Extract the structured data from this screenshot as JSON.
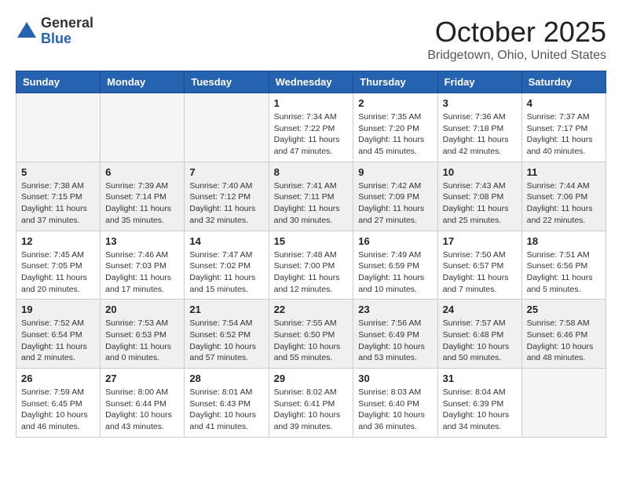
{
  "header": {
    "logo_general": "General",
    "logo_blue": "Blue",
    "month_title": "October 2025",
    "location": "Bridgetown, Ohio, United States"
  },
  "days_of_week": [
    "Sunday",
    "Monday",
    "Tuesday",
    "Wednesday",
    "Thursday",
    "Friday",
    "Saturday"
  ],
  "weeks": [
    [
      {
        "num": "",
        "info": ""
      },
      {
        "num": "",
        "info": ""
      },
      {
        "num": "",
        "info": ""
      },
      {
        "num": "1",
        "info": "Sunrise: 7:34 AM\nSunset: 7:22 PM\nDaylight: 11 hours and 47 minutes."
      },
      {
        "num": "2",
        "info": "Sunrise: 7:35 AM\nSunset: 7:20 PM\nDaylight: 11 hours and 45 minutes."
      },
      {
        "num": "3",
        "info": "Sunrise: 7:36 AM\nSunset: 7:18 PM\nDaylight: 11 hours and 42 minutes."
      },
      {
        "num": "4",
        "info": "Sunrise: 7:37 AM\nSunset: 7:17 PM\nDaylight: 11 hours and 40 minutes."
      }
    ],
    [
      {
        "num": "5",
        "info": "Sunrise: 7:38 AM\nSunset: 7:15 PM\nDaylight: 11 hours and 37 minutes."
      },
      {
        "num": "6",
        "info": "Sunrise: 7:39 AM\nSunset: 7:14 PM\nDaylight: 11 hours and 35 minutes."
      },
      {
        "num": "7",
        "info": "Sunrise: 7:40 AM\nSunset: 7:12 PM\nDaylight: 11 hours and 32 minutes."
      },
      {
        "num": "8",
        "info": "Sunrise: 7:41 AM\nSunset: 7:11 PM\nDaylight: 11 hours and 30 minutes."
      },
      {
        "num": "9",
        "info": "Sunrise: 7:42 AM\nSunset: 7:09 PM\nDaylight: 11 hours and 27 minutes."
      },
      {
        "num": "10",
        "info": "Sunrise: 7:43 AM\nSunset: 7:08 PM\nDaylight: 11 hours and 25 minutes."
      },
      {
        "num": "11",
        "info": "Sunrise: 7:44 AM\nSunset: 7:06 PM\nDaylight: 11 hours and 22 minutes."
      }
    ],
    [
      {
        "num": "12",
        "info": "Sunrise: 7:45 AM\nSunset: 7:05 PM\nDaylight: 11 hours and 20 minutes."
      },
      {
        "num": "13",
        "info": "Sunrise: 7:46 AM\nSunset: 7:03 PM\nDaylight: 11 hours and 17 minutes."
      },
      {
        "num": "14",
        "info": "Sunrise: 7:47 AM\nSunset: 7:02 PM\nDaylight: 11 hours and 15 minutes."
      },
      {
        "num": "15",
        "info": "Sunrise: 7:48 AM\nSunset: 7:00 PM\nDaylight: 11 hours and 12 minutes."
      },
      {
        "num": "16",
        "info": "Sunrise: 7:49 AM\nSunset: 6:59 PM\nDaylight: 11 hours and 10 minutes."
      },
      {
        "num": "17",
        "info": "Sunrise: 7:50 AM\nSunset: 6:57 PM\nDaylight: 11 hours and 7 minutes."
      },
      {
        "num": "18",
        "info": "Sunrise: 7:51 AM\nSunset: 6:56 PM\nDaylight: 11 hours and 5 minutes."
      }
    ],
    [
      {
        "num": "19",
        "info": "Sunrise: 7:52 AM\nSunset: 6:54 PM\nDaylight: 11 hours and 2 minutes."
      },
      {
        "num": "20",
        "info": "Sunrise: 7:53 AM\nSunset: 6:53 PM\nDaylight: 11 hours and 0 minutes."
      },
      {
        "num": "21",
        "info": "Sunrise: 7:54 AM\nSunset: 6:52 PM\nDaylight: 10 hours and 57 minutes."
      },
      {
        "num": "22",
        "info": "Sunrise: 7:55 AM\nSunset: 6:50 PM\nDaylight: 10 hours and 55 minutes."
      },
      {
        "num": "23",
        "info": "Sunrise: 7:56 AM\nSunset: 6:49 PM\nDaylight: 10 hours and 53 minutes."
      },
      {
        "num": "24",
        "info": "Sunrise: 7:57 AM\nSunset: 6:48 PM\nDaylight: 10 hours and 50 minutes."
      },
      {
        "num": "25",
        "info": "Sunrise: 7:58 AM\nSunset: 6:46 PM\nDaylight: 10 hours and 48 minutes."
      }
    ],
    [
      {
        "num": "26",
        "info": "Sunrise: 7:59 AM\nSunset: 6:45 PM\nDaylight: 10 hours and 46 minutes."
      },
      {
        "num": "27",
        "info": "Sunrise: 8:00 AM\nSunset: 6:44 PM\nDaylight: 10 hours and 43 minutes."
      },
      {
        "num": "28",
        "info": "Sunrise: 8:01 AM\nSunset: 6:43 PM\nDaylight: 10 hours and 41 minutes."
      },
      {
        "num": "29",
        "info": "Sunrise: 8:02 AM\nSunset: 6:41 PM\nDaylight: 10 hours and 39 minutes."
      },
      {
        "num": "30",
        "info": "Sunrise: 8:03 AM\nSunset: 6:40 PM\nDaylight: 10 hours and 36 minutes."
      },
      {
        "num": "31",
        "info": "Sunrise: 8:04 AM\nSunset: 6:39 PM\nDaylight: 10 hours and 34 minutes."
      },
      {
        "num": "",
        "info": ""
      }
    ]
  ],
  "shaded_rows": [
    1,
    3
  ],
  "colors": {
    "header_bg": "#2563b0",
    "shaded_row": "#f0f0f0",
    "empty_cell": "#f5f5f5"
  }
}
